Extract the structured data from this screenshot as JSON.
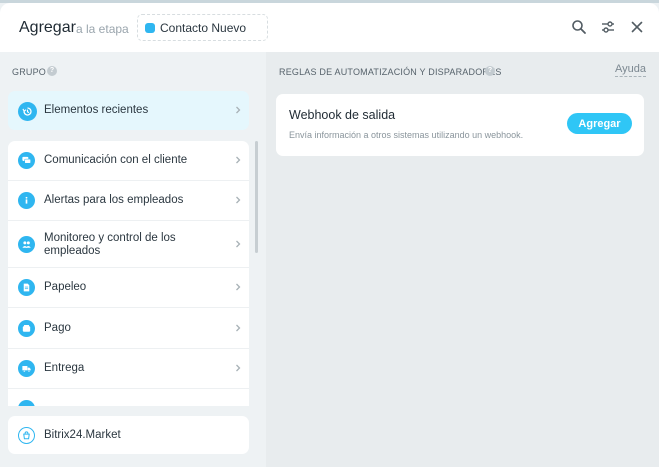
{
  "header": {
    "title": "Agregar",
    "stage_prefix": "a la etapa",
    "stage_value": "Contacto Nuevo",
    "stage_color": "#2fb6f0"
  },
  "left": {
    "section_title": "GRUPO",
    "recent": {
      "label": "Elementos recientes",
      "icon": "history-icon"
    },
    "groups": [
      {
        "label": "Comunicación con el cliente",
        "icon": "chat-icon"
      },
      {
        "label": "Alertas para los empleados",
        "icon": "info-icon"
      },
      {
        "label": "Monitoreo y control de los empleados",
        "icon": "users-icon"
      },
      {
        "label": "Papeleo",
        "icon": "document-icon"
      },
      {
        "label": "Pago",
        "icon": "wallet-icon"
      },
      {
        "label": "Entrega",
        "icon": "truck-icon"
      }
    ],
    "market": {
      "label": "Bitrix24.Market",
      "icon": "market-icon"
    }
  },
  "right": {
    "section_title": "REGLAS DE AUTOMATIZACIÓN Y DISPARADORES",
    "help_link": "Ayuda",
    "webhook": {
      "title": "Webhook de salida",
      "description": "Envía información a otros sistemas utilizando un webhook.",
      "button": "Agregar"
    }
  },
  "colors": {
    "accent": "#2fc6f6",
    "icon": "#2fb6f0",
    "recent_bg": "#e5f7fd"
  }
}
